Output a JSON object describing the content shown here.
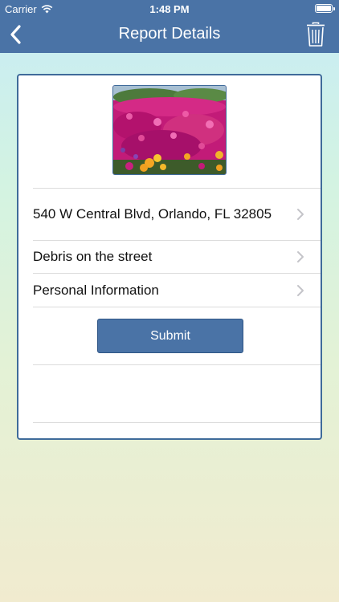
{
  "status_bar": {
    "carrier": "Carrier",
    "time": "1:48 PM"
  },
  "nav": {
    "title": "Report Details",
    "back_icon": "chevron-left-icon",
    "trash_icon": "trash-icon"
  },
  "report": {
    "address": "540 W Central Blvd, Orlando, FL  32805",
    "category": "Debris on the street",
    "personal_info_label": "Personal Information",
    "submit_label": "Submit"
  },
  "colors": {
    "nav_bar": "#4a73a6",
    "card_border": "#3f6b9a",
    "button": "#4a73a6"
  }
}
